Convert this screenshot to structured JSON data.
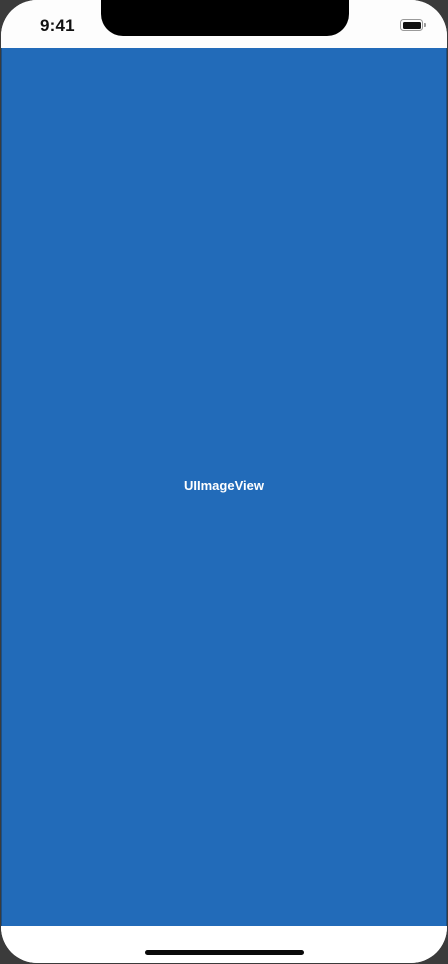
{
  "status_bar": {
    "time": "9:41",
    "battery_icon": "battery-full-icon",
    "battery_level": 1.0
  },
  "image_view": {
    "label": "UIImageView",
    "background_color": "#226bb9"
  },
  "home_indicator_icon": "home-indicator"
}
